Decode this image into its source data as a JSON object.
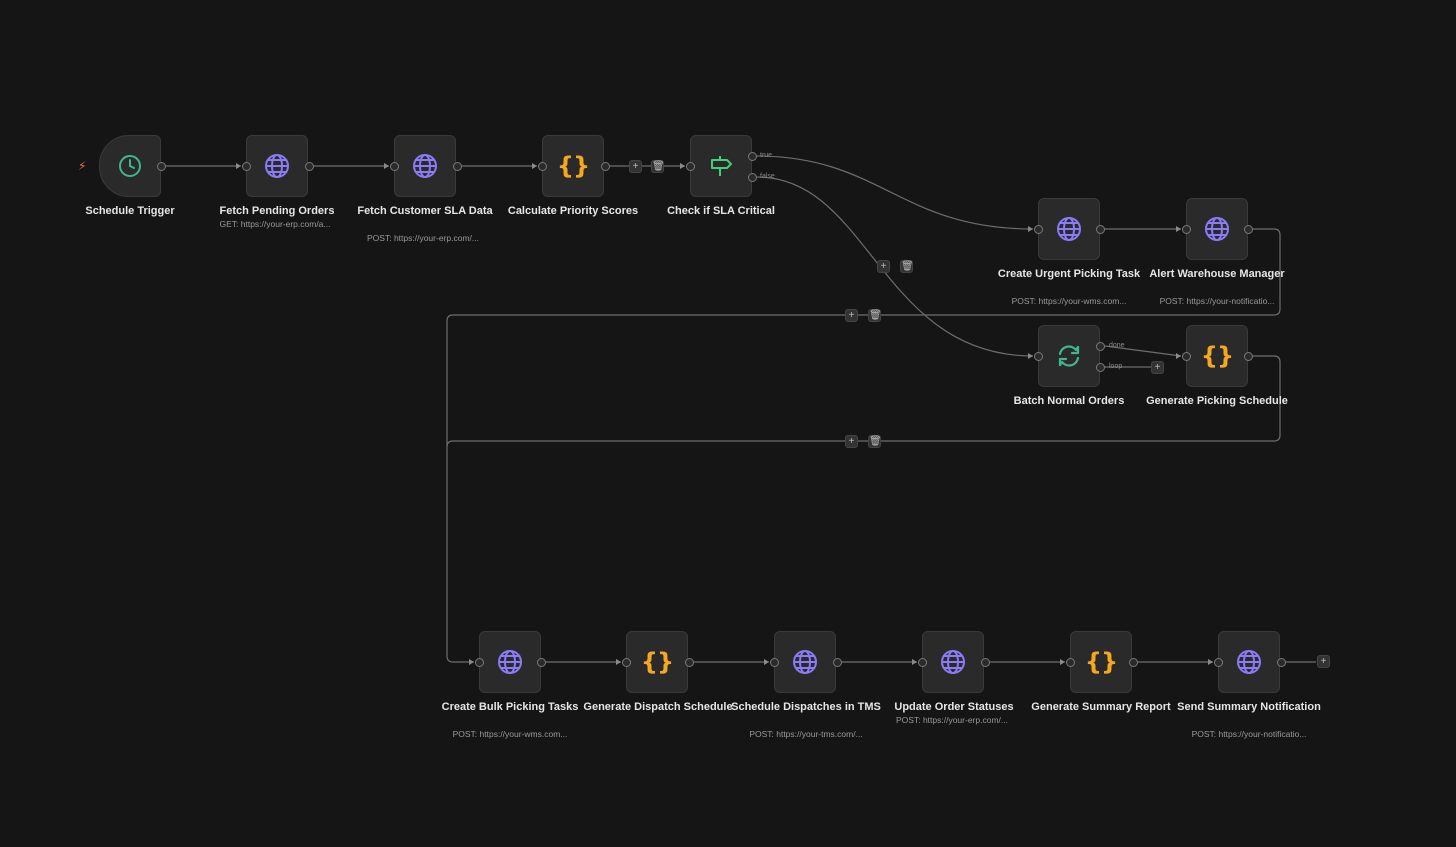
{
  "nodes": [
    {
      "id": "n1",
      "label": "Schedule Trigger",
      "sub": "",
      "icon": "clock-icon",
      "kind": "trigger"
    },
    {
      "id": "n2",
      "label": "Fetch Pending Orders",
      "sub": "GET: https://your-erp.com/a...",
      "icon": "globe-icon"
    },
    {
      "id": "n3",
      "label": "Fetch Customer SLA Data",
      "sub": "POST: https://your-erp.com/...",
      "icon": "globe-icon"
    },
    {
      "id": "n4",
      "label": "Calculate Priority Scores",
      "sub": "",
      "icon": "code-braces-icon"
    },
    {
      "id": "n5",
      "label": "Check if SLA Critical",
      "sub": "",
      "icon": "signpost-icon"
    },
    {
      "id": "n6",
      "label": "Create Urgent Picking Task",
      "sub": "POST: https://your-wms.com...",
      "icon": "globe-icon"
    },
    {
      "id": "n7",
      "label": "Alert Warehouse Manager",
      "sub": "POST: https://your-notificatio...",
      "icon": "globe-icon"
    },
    {
      "id": "n8",
      "label": "Batch Normal Orders",
      "sub": "",
      "icon": "loop-icon"
    },
    {
      "id": "n9",
      "label": "Generate Picking Schedule",
      "sub": "",
      "icon": "code-braces-icon"
    },
    {
      "id": "n10",
      "label": "Create Bulk Picking Tasks",
      "sub": "POST: https://your-wms.com...",
      "icon": "globe-icon"
    },
    {
      "id": "n11",
      "label": "Generate Dispatch Schedule",
      "sub": "",
      "icon": "code-braces-icon"
    },
    {
      "id": "n12",
      "label": "Schedule Dispatches in TMS",
      "sub": "POST: https://your-tms.com/...",
      "icon": "globe-icon"
    },
    {
      "id": "n13",
      "label": "Update Order Statuses",
      "sub": "POST: https://your-erp.com/...",
      "icon": "globe-icon"
    },
    {
      "id": "n14",
      "label": "Generate Summary Report",
      "sub": "",
      "icon": "code-braces-icon"
    },
    {
      "id": "n15",
      "label": "Send Summary Notification",
      "sub": "POST: https://your-notificatio...",
      "icon": "globe-icon"
    }
  ],
  "outputs": {
    "if_true": "true",
    "if_false": "false",
    "batch_done": "done",
    "batch_loop": "loop"
  },
  "controls": {
    "add": "+",
    "delete_icon": "trash-icon"
  },
  "colors": {
    "globe": "#8b7cf6",
    "code": "#f5a623",
    "clock": "#3fb68b",
    "signpost": "#3fd17a",
    "loop": "#3fb68b",
    "wire": "#7a7a7a",
    "trigger_bolt": "#ef6a4b"
  }
}
